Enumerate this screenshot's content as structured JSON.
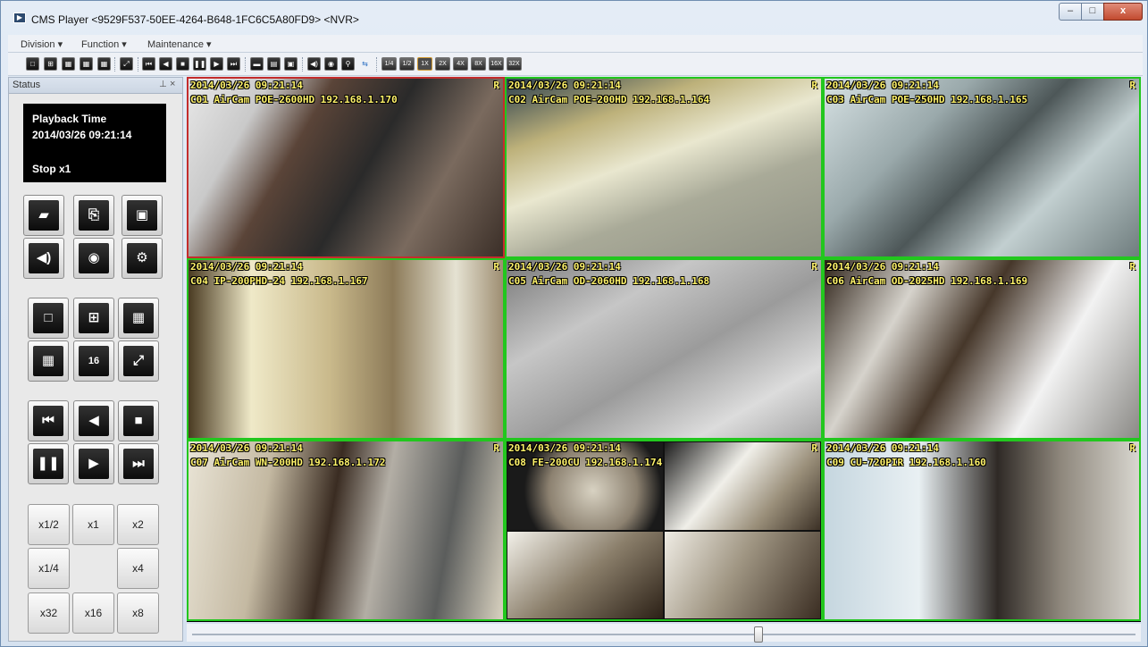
{
  "window": {
    "title": "CMS Player <9529F537-50EE-4264-B648-1FC6C5A80FD9> <NVR>",
    "icon": "app-icon",
    "controls": {
      "minimize": "–",
      "maximize": "□",
      "close": "x"
    }
  },
  "menu": [
    "Division ▾",
    "Function ▾",
    "Maintenance ▾"
  ],
  "toolbar": {
    "speeds": [
      "1/4",
      "1/2",
      "1X",
      "2X",
      "4X",
      "8X",
      "16X",
      "32X"
    ],
    "selected_speed": "1X"
  },
  "status_panel": {
    "title": "Status",
    "pin": "⊥",
    "close": "×",
    "playback_label": "Playback Time",
    "playback_time": "2014/03/26 09:21:14",
    "playback_state": "Stop   x1",
    "action_buttons": [
      "open-folder-icon",
      "export-icon",
      "save-icon",
      "audio-icon",
      "snapshot-icon",
      "settings-icon"
    ],
    "layout_buttons": [
      "layout-1-icon",
      "layout-4-icon",
      "layout-6-icon",
      "layout-9-icon",
      "layout-16-icon",
      "fullscreen-icon"
    ],
    "transport_buttons": [
      "skip-back-icon",
      "reverse-play-icon",
      "stop-icon",
      "pause-icon",
      "play-icon",
      "skip-forward-icon"
    ],
    "speed_buttons": [
      "x1/2",
      "x1",
      "x2",
      "x1/4",
      "x4",
      "x32",
      "x16",
      "x8"
    ]
  },
  "cameras": [
    {
      "timestamp": "2014/03/26 09:21:14",
      "name": "C01 AirCam POE-2600HD 192.168.1.170",
      "rec": "R",
      "status_color": "#c42d2d"
    },
    {
      "timestamp": "2014/03/26 09:21:14",
      "name": "C02 AirCam POE-200HD 192.168.1.164",
      "rec": "R",
      "status_color": "#22c71e"
    },
    {
      "timestamp": "2014/03/26 09:21:14",
      "name": "C03 AirCam POE-250HD 192.168.1.165",
      "rec": "R",
      "status_color": "#22c71e"
    },
    {
      "timestamp": "2014/03/26 09:21:14",
      "name": "C04 IP-200PHD-24 192.168.1.167",
      "rec": "R",
      "status_color": "#22c71e"
    },
    {
      "timestamp": "2014/03/26 09:21:14",
      "name": "C05 AirCam OD-2060HD 192.168.1.168",
      "rec": "R",
      "status_color": "#22c71e"
    },
    {
      "timestamp": "2014/03/26 09:21:14",
      "name": "C06 AirCam OD-2025HD 192.168.1.169",
      "rec": "R",
      "status_color": "#22c71e"
    },
    {
      "timestamp": "2014/03/26 09:21:14",
      "name": "C07 AirCam WN-200HD 192.168.1.172",
      "rec": "R",
      "status_color": "#22c71e"
    },
    {
      "timestamp": "2014/03/26 09:21:14",
      "name": "C08 FE-200CU 192.168.1.174",
      "rec": "R",
      "status_color": "#22c71e"
    },
    {
      "timestamp": "2014/03/26 09:21:14",
      "name": "C09 CU-720PIR 192.168.1.160",
      "rec": "R",
      "status_color": "#22c71e"
    }
  ],
  "seek": {
    "position": 0.6
  }
}
